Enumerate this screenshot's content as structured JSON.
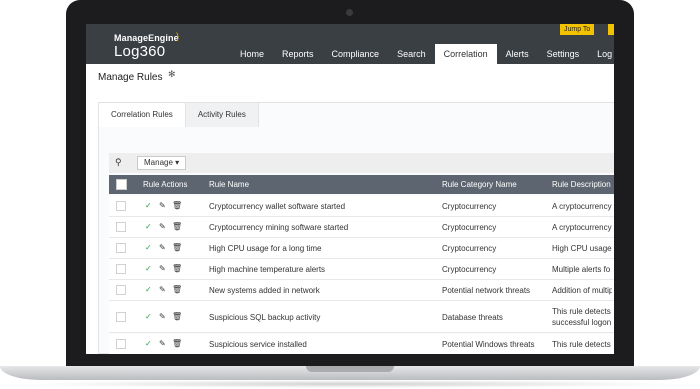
{
  "app": {
    "brand_small": "ManageEngine",
    "brand_name": "Log360",
    "jump_to": "Jump To"
  },
  "nav": {
    "tabs": [
      "Home",
      "Reports",
      "Compliance",
      "Search",
      "Correlation",
      "Alerts",
      "Settings",
      "Log Me"
    ],
    "active": "Correlation"
  },
  "page": {
    "title": "Manage Rules"
  },
  "tabs": [
    "Correlation Rules",
    "Activity Rules"
  ],
  "toolbar": {
    "manage_label": "Manage ▾"
  },
  "table": {
    "headers": {
      "actions": "Rule Actions",
      "name": "Rule Name",
      "category": "Rule Category Name",
      "description": "Rule Description"
    },
    "rows": [
      {
        "name": "Cryptocurrency wallet software started",
        "category": "Cryptocurrency",
        "description": "A cryptocurrency"
      },
      {
        "name": "Cryptocurrency mining software started",
        "category": "Cryptocurrency",
        "description": "A cryptocurrency"
      },
      {
        "name": "High CPU usage for a long time",
        "category": "Cryptocurrency",
        "description": "High CPU usage fo"
      },
      {
        "name": "High machine temperature alerts",
        "category": "Cryptocurrency",
        "description": "Multiple alerts fo"
      },
      {
        "name": "New systems added in network",
        "category": "Potential network threats",
        "description": "Addition of multip"
      },
      {
        "name": "Suspicious SQL backup activity",
        "category": "Database threats",
        "description": "This rule detects s",
        "description2": "successful logon t"
      },
      {
        "name": "Suspicious service installed",
        "category": "Potential Windows threats",
        "description": "This rule detects"
      }
    ]
  },
  "colors": {
    "topbar": "#3a3f44",
    "table_header": "#5d6670",
    "accent": "#f2c200",
    "enabled": "#2e9e4f"
  }
}
